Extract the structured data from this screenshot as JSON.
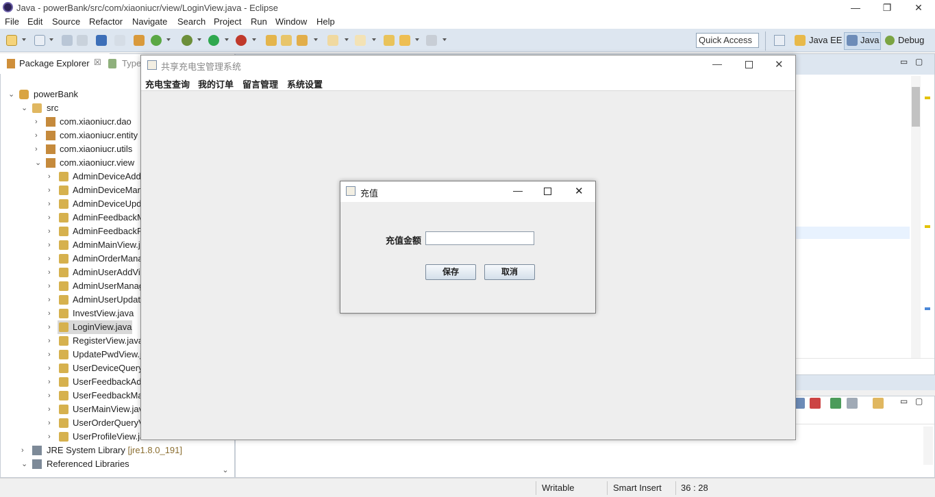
{
  "window": {
    "title": "Java - powerBank/src/com/xiaoniucr/view/LoginView.java - Eclipse",
    "min": "—",
    "max": "❐",
    "close": "✕"
  },
  "menu": [
    "File",
    "Edit",
    "Source",
    "Refactor",
    "Navigate",
    "Search",
    "Project",
    "Run",
    "Window",
    "Help"
  ],
  "toolbar": {
    "quick_access": "Quick Access"
  },
  "perspectives": {
    "java_ee": "Java EE",
    "java": "Java",
    "debug": "Debug"
  },
  "explorer": {
    "tab_label": "Package Explorer",
    "tab2_label": "Type",
    "project": "powerBank",
    "src": "src",
    "packages": [
      "com.xiaoniucr.dao",
      "com.xiaoniucr.entity",
      "com.xiaoniucr.utils",
      "com.xiaoniucr.view"
    ],
    "files": [
      "AdminDeviceAdd",
      "AdminDeviceMan",
      "AdminDeviceUpd",
      "AdminFeedbackM",
      "AdminFeedbackR",
      "AdminMainView.j",
      "AdminOrderMana",
      "AdminUserAddVi",
      "AdminUserManag",
      "AdminUserUpdat",
      "InvestView.java",
      "LoginView.java",
      "RegisterView.java",
      "UpdatePwdView.j",
      "UserDeviceQuery",
      "UserFeedbackAd",
      "UserFeedbackMa",
      "UserMainView.jav",
      "UserOrderQueryV",
      "UserProfileView.java"
    ],
    "jre": "JRE System Library",
    "jre_version": "[jre1.8.0_191]",
    "ref": "Referenced Libraries"
  },
  "status": {
    "writable": "Writable",
    "insert": "Smart Insert",
    "position": "36 : 28"
  },
  "app_frame": {
    "title": "共享充电宝管理系统",
    "menu": [
      "充电宝查询",
      "我的订单",
      "留言管理",
      "系统设置"
    ]
  },
  "dialog": {
    "title": "充值",
    "amount_label": "充值金额",
    "amount_value": "",
    "save": "保存",
    "cancel": "取消"
  }
}
